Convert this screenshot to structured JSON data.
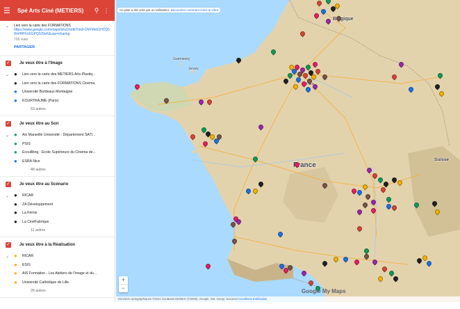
{
  "app": {
    "title": "Spé Arts Ciné (METIERS)"
  },
  "intro": {
    "text": "Lien vers la carte des FORMATIONS",
    "link": "https://www.google.com/maps/d/u/2/edit?mid=1NFMn61HCQ5WxfHPXcKGPQ9J9xK&usp=sharing",
    "views": "726 vues",
    "share": "PARTAGER"
  },
  "layers": [
    {
      "title": "Je veux être à l'Image",
      "items": [
        {
          "label": "Lien vers la carte des METIERS Arts Plastiq...",
          "color": "#202124"
        },
        {
          "label": "Lien vers la carte des FORMATIONS Cinéma",
          "color": "#202124"
        },
        {
          "label": "Université Bordeaux Montaigne",
          "color": "#1a73e8"
        },
        {
          "label": "KOURTRAJMÉ (Paris)",
          "color": "#1a73e8"
        }
      ],
      "more": "53 autres"
    },
    {
      "title": "Je veux être au Son",
      "items": [
        {
          "label": "Aix Marseille Université - Département SATI...",
          "color": "#0f9d58"
        },
        {
          "label": "PSIS",
          "color": "#0f9d58"
        },
        {
          "label": "Ecoulliling - Ecole Supérieure du Cinéma de...",
          "color": "#0f9d58"
        },
        {
          "label": "ESRA Nice",
          "color": "#1a73e8"
        }
      ],
      "more": "48 autres"
    },
    {
      "title": "Je veux être au Scénario",
      "items": [
        {
          "label": "RICAR",
          "color": "#202124"
        },
        {
          "label": "ZA Développement",
          "color": "#202124"
        },
        {
          "label": "La Fémis",
          "color": "#202124"
        },
        {
          "label": "La CinéFabrique",
          "color": "#202124"
        }
      ],
      "more": "11 autres"
    },
    {
      "title": "Je veux être à la Réalisation",
      "items": [
        {
          "label": "RICAR",
          "color": "#f4b400"
        },
        {
          "label": "ESIS",
          "color": "#f4b400"
        },
        {
          "label": "AIS Formation - Les Ateliers de l'Image et du...",
          "color": "#f4b400"
        },
        {
          "label": "Université Catholique de Lille",
          "color": "#f4b400"
        }
      ],
      "more": "26 autres"
    }
  ],
  "map": {
    "notice_text": "Ce plan a été créé par un utilisateur.",
    "notice_link": "Découvrez comment créer le vôtre",
    "labels": {
      "france": "France",
      "belgique": "Belgique",
      "guernesey": "Guernesey",
      "jersey": "Jersey",
      "suisse": "Suisse",
      "paris": "Paris"
    },
    "google": "Google My Maps",
    "attribution": "Données cartographiques ©2021 GeoBasis-DE/BKG (©2009), Google, Inst. Geogr. Nacional",
    "attribution_terms": "Conditions d'utilisation",
    "zoom_in": "+",
    "zoom_out": "−"
  },
  "colors": {
    "accent": "#db4437",
    "sea": "#aadaff",
    "land": "#e8d9b8"
  }
}
